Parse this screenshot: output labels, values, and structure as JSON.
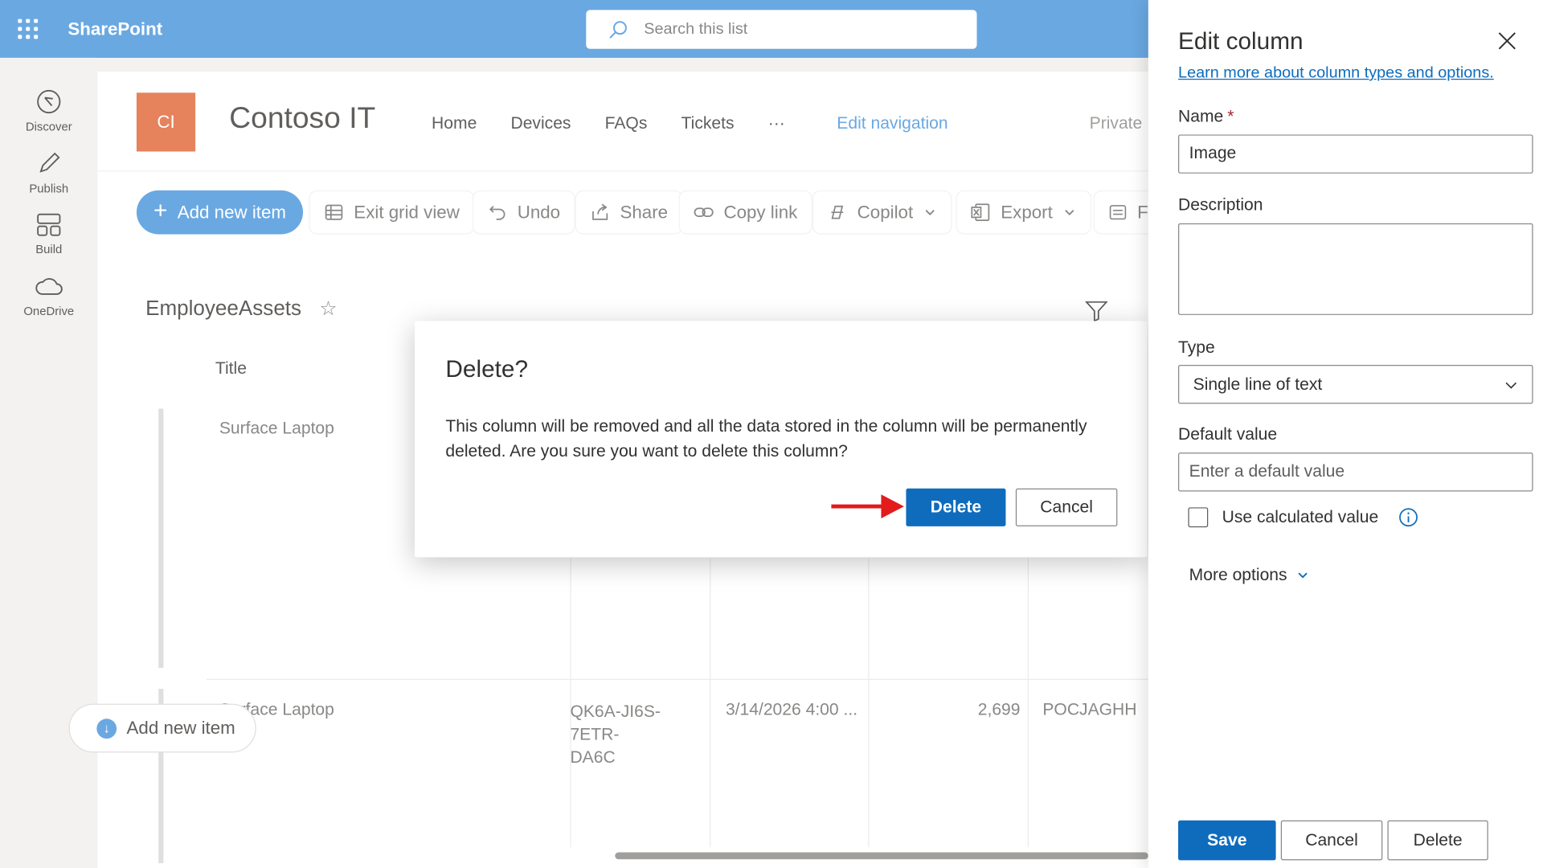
{
  "suite": {
    "app_name": "SharePoint",
    "search_placeholder": "Search this list"
  },
  "rail": {
    "items": [
      {
        "label": "Discover",
        "icon": "compass-icon"
      },
      {
        "label": "Publish",
        "icon": "pen-icon"
      },
      {
        "label": "Build",
        "icon": "layout-icon"
      },
      {
        "label": "OneDrive",
        "icon": "cloud-icon"
      }
    ]
  },
  "site": {
    "logo_initials": "CI",
    "title": "Contoso IT",
    "nav": [
      "Home",
      "Devices",
      "FAQs",
      "Tickets",
      "···"
    ],
    "edit_nav": "Edit navigation",
    "privacy": "Private"
  },
  "commands": {
    "add_new_item": "Add new item",
    "exit_grid": "Exit grid view",
    "undo": "Undo",
    "share": "Share",
    "copy_link": "Copy link",
    "copilot": "Copilot",
    "export": "Export",
    "forms": "Fo"
  },
  "list": {
    "title": "EmployeeAssets",
    "column_title": "Title",
    "rows": [
      {
        "title": "Surface Laptop"
      },
      {
        "title": "Surface Laptop",
        "key_line1": "QK6A-JI6S-7ETR-",
        "key_line2": "DA6C",
        "date": "3/14/2026 4:00 ...",
        "price": "2,699",
        "code": "POCJAGHH"
      }
    ],
    "add_new_item": "Add new item"
  },
  "dialog": {
    "title": "Delete?",
    "message": "This column will be removed and all the data stored in the column will be permanently deleted. Are you sure you want to delete this column?",
    "delete_label": "Delete",
    "cancel_label": "Cancel"
  },
  "panel": {
    "title": "Edit column",
    "learn_more": "Learn more about column types and options.",
    "name_label": "Name",
    "required_mark": "*",
    "name_value": "Image",
    "description_label": "Description",
    "description_value": "",
    "type_label": "Type",
    "type_value": "Single line of text",
    "default_label": "Default value",
    "default_placeholder": "Enter a default value",
    "calculated_label": "Use calculated value",
    "calculated_checked": false,
    "more_options": "More options",
    "save_label": "Save",
    "cancel_label": "Cancel",
    "delete_label": "Delete"
  },
  "colors": {
    "suitebar": "#6aa8e2",
    "primary": "#0f6cbd",
    "site_logo": "#e6825c",
    "annotation_arrow": "#e21b1b"
  }
}
